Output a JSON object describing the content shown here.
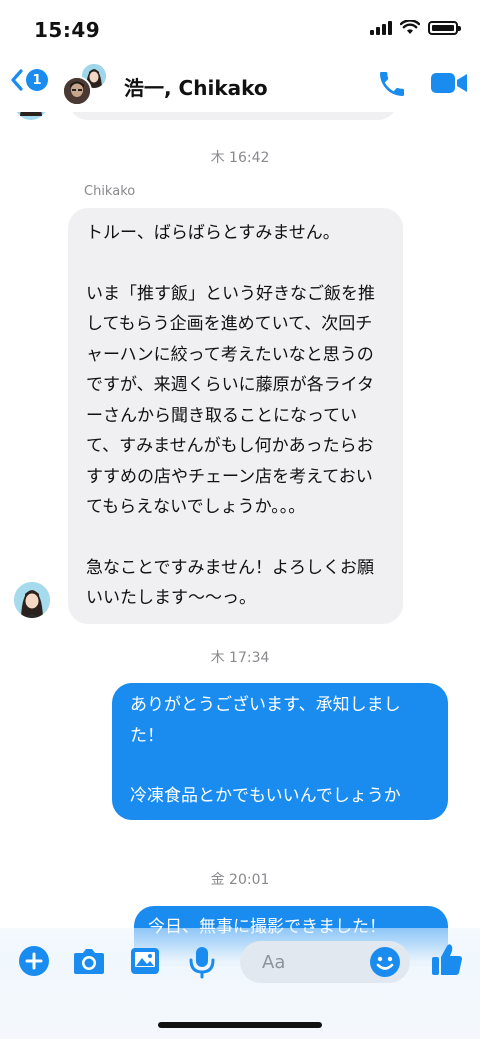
{
  "status": {
    "time": "15:49"
  },
  "header": {
    "back_count": "1",
    "title": "浩一, Chikako"
  },
  "messages": {
    "ts1": "木 16:42",
    "sender": "Chikako",
    "incoming": {
      "line1": "トルー、ばらばらとすみません。",
      "para2": "いま「推す飯」という好きなご飯を推してもらう企画を進めていて、次回チャーハンに絞って考えたいなと思うのですが、来週くらいに藤原が各ライターさんから聞き取ることになっていて、すみませんがもし何かあったらおすすめの店やチェーン店を考えておいてもらえないでしょうか。。。",
      "para3": "急なことですみません！よろしくお願いいたします〜〜っ。"
    },
    "ts2": "木 17:34",
    "outgoing": {
      "line1": "ありがとうございます、承知しました！",
      "line2": "冷凍食品とかでもいいんでしょうか"
    },
    "ts3": "金 20:01",
    "outgoing2": "今日、無事に撮影できました！"
  },
  "composer": {
    "placeholder": "Aa"
  },
  "colors": {
    "accent": "#1a8cf0",
    "incoming_bubble": "#f0f0f2",
    "timestamp": "#8a8a8e"
  },
  "icons": [
    "chevron-left-icon",
    "phone-icon",
    "video-camera-icon",
    "plus-icon",
    "camera-icon",
    "image-icon",
    "microphone-icon",
    "emoji-icon",
    "thumbs-up-icon"
  ]
}
